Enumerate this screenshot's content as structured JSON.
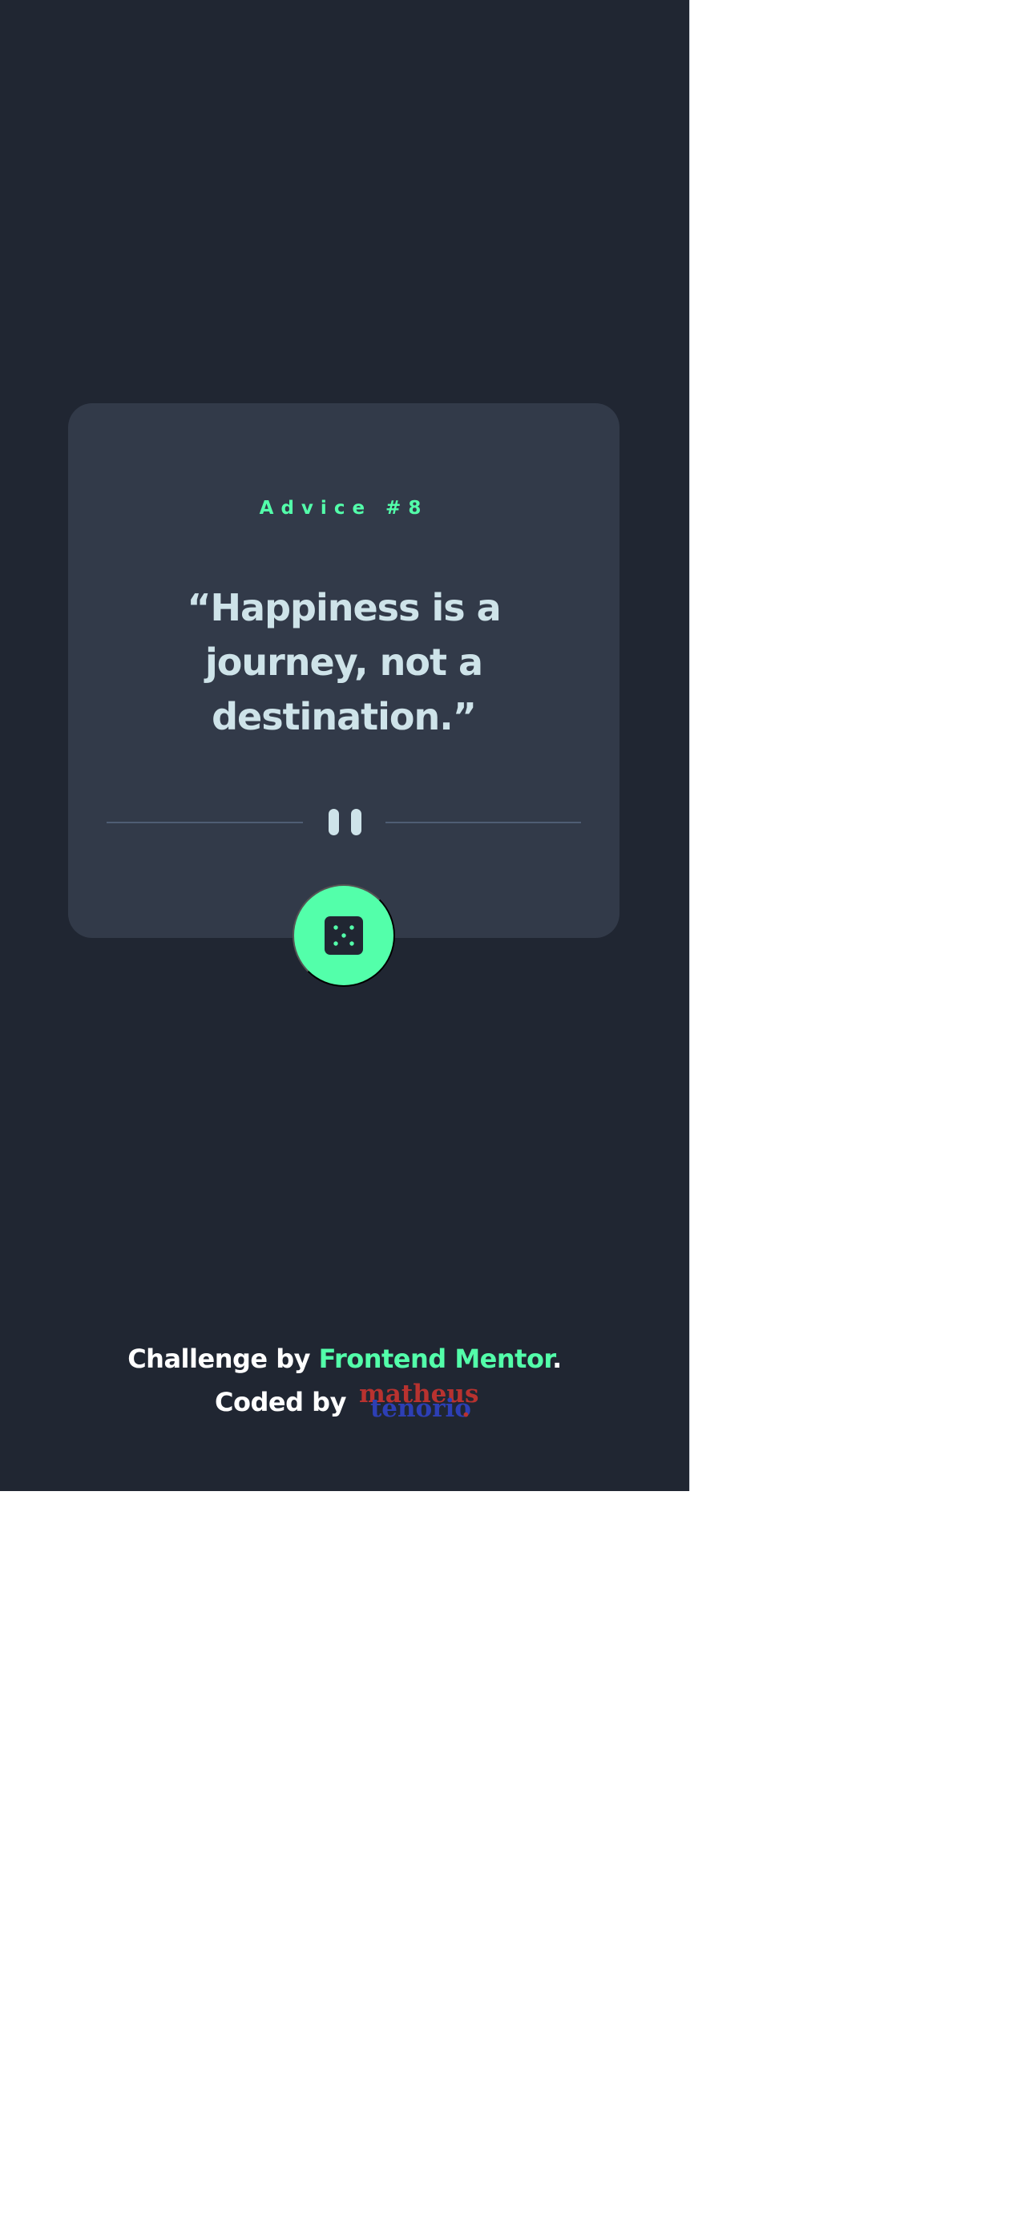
{
  "card": {
    "advice_label": "Advice #8",
    "quote": "“Happiness is a journey, not a destination.”"
  },
  "divider": {
    "icon": "pause-icon"
  },
  "dice_button": {
    "icon": "dice-icon"
  },
  "attribution": {
    "challenge_prefix": "Challenge by ",
    "challenge_link": "Frontend Mentor",
    "challenge_suffix": ".",
    "coded_prefix": "Coded by",
    "signature_first": "matheus",
    "signature_last": "tenorio",
    "signature_dot": "."
  },
  "colors": {
    "background": "#202632",
    "card": "#323a49",
    "accent": "#53ffaa",
    "text": "#cee3e9",
    "divider": "#4f5d74",
    "signature_red": "#b8322f",
    "signature_blue": "#2d3fb5"
  }
}
